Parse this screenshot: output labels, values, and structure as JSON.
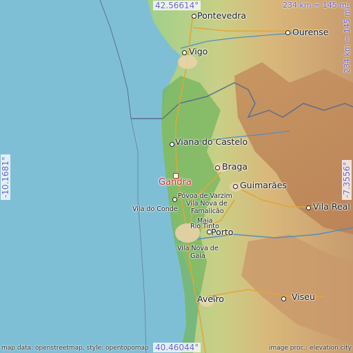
{
  "map": {
    "places": {
      "pontevedra": "Pontevedra",
      "ourense": "Ourense",
      "vigo": "Vigo",
      "viana": "Viana do Castelo",
      "braga": "Braga",
      "gandra": "Gandra",
      "guimaraes": "Guimarães",
      "povoa": "Póvoa de Varzim",
      "vila_nova_famalicao_1": "Vila Nova de",
      "vila_nova_famalicao_2": "Famalicão",
      "vila_do_conde": "Vila do Conde",
      "vila_real": "Vila Real",
      "maia": "Maia",
      "rio_tinto": "Rio Tinto",
      "porto": "Porto",
      "vila_nova_gaia_1": "Vila Nova de",
      "vila_nova_gaia_2": "Gaia",
      "aveiro": "Aveiro",
      "viseu": "Viseu"
    },
    "coords": {
      "top": "42.56614°",
      "bottom": "40.46044°",
      "left": "-10.1681°",
      "right": "-7.3556°"
    },
    "scale": {
      "horizontal": "234 km = 145 mi",
      "vertical": "234 km = 145 mi"
    },
    "credits": {
      "left": "map data: openstreetmap, style: opentopomap",
      "right": "image proc.: elevation.city"
    },
    "colors": {
      "sea": "#7fbfd6",
      "highlight": "#d6282e",
      "coord_text": "#6a5fd0"
    }
  }
}
